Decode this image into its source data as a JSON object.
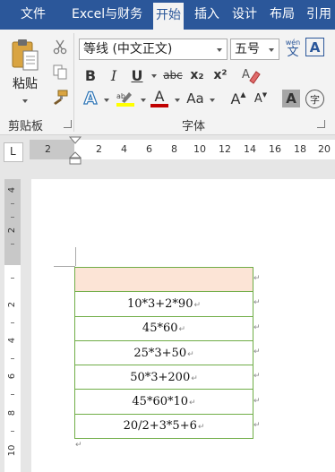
{
  "tabs": [
    {
      "label": "文件",
      "active": false
    },
    {
      "label": "Excel与财务",
      "active": false
    },
    {
      "label": "开始",
      "active": true
    },
    {
      "label": "插入",
      "active": false
    },
    {
      "label": "设计",
      "active": false
    },
    {
      "label": "布局",
      "active": false
    },
    {
      "label": "引用",
      "active": false
    }
  ],
  "clipboard": {
    "paste_label": "粘贴",
    "group_label": "剪贴板"
  },
  "font": {
    "font_name": "等线 (中文正文)",
    "font_size": "五号",
    "group_label": "字体",
    "bold": "B",
    "italic": "I",
    "underline": "U",
    "strikethrough": "abc",
    "subscript": "x₂",
    "superscript": "x²",
    "font_color_glyph": "A",
    "text_effects_glyph": "A",
    "change_case": "Aa",
    "grow_font": "A",
    "shrink_font": "A",
    "char_shading": "A",
    "enclose_char": "字",
    "phonetic_top": "wén",
    "phonetic_bottom": "文",
    "char_border": "A",
    "highlight_glyph": "ab"
  },
  "colors": {
    "accent": "#2b579a",
    "highlight_yellow": "#ffff00",
    "font_red": "#c00000",
    "table_border": "#70ad47",
    "header_fill": "#fce4d6"
  },
  "ruler": {
    "tab_selector": "L",
    "numbers": [
      "2",
      "2",
      "4",
      "6",
      "8",
      "10",
      "12",
      "14",
      "16",
      "18",
      "20"
    ]
  },
  "vertical_ruler": {
    "numbers": [
      "4",
      "2",
      "2",
      "4",
      "6",
      "8",
      "10"
    ]
  },
  "table": {
    "header": "",
    "rows": [
      "10*3+2*90",
      "45*60",
      "25*3+50",
      "50*3+200",
      "45*60*10",
      "20/2+3*5+6"
    ]
  },
  "marks": {
    "cell_end": "↵",
    "row_end": "↵",
    "paragraph": "↵"
  }
}
